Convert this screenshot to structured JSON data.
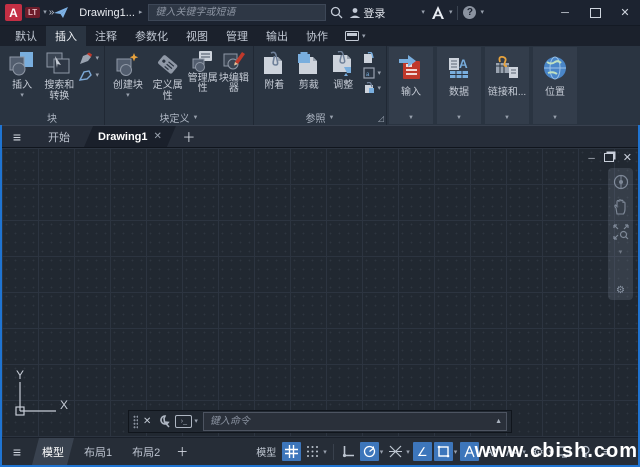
{
  "colors": {
    "accent_blue": "#1f74d2",
    "active_tool_blue": "#3d76bb",
    "titlebar_bg": "#1c2330",
    "ribbon_bg": "#2a3441",
    "canvas_bg": "#212831",
    "statusbar_bg": "#262d37",
    "app_icon_red": "#c32f44"
  },
  "glyphs": {
    "caret_down": "▾",
    "caret_down_small": "▼",
    "caret_right": "▸",
    "double_chevron": "»",
    "close": "✕",
    "minimize": "─",
    "plus": "＋",
    "hamburger": "≡",
    "up_arrow": "▲",
    "angle": "∠",
    "question": "?",
    "launcher": "◿",
    "gear": "⚙",
    "prompt": "›_"
  },
  "titlebar": {
    "app_initial": "A",
    "app_badge": "LT",
    "doc_title": "Drawing1...",
    "search_placeholder": "键入关键字或短语",
    "signin": "登录"
  },
  "ribbon_tabs": [
    {
      "label": "默认"
    },
    {
      "label": "插入"
    },
    {
      "label": "注释"
    },
    {
      "label": "参数化"
    },
    {
      "label": "视图"
    },
    {
      "label": "管理"
    },
    {
      "label": "输出"
    },
    {
      "label": "协作"
    }
  ],
  "active_ribbon_tab": "插入",
  "panels": {
    "block": {
      "title": "块",
      "insert": "插入",
      "search_convert": "搜索和转换"
    },
    "block_def": {
      "title": "块定义",
      "create": "创建块",
      "def_attr": "定义属性",
      "manage_attr": "管理属性",
      "block_editor": "块编辑器"
    },
    "reference": {
      "title": "参照",
      "attach": "附着",
      "clip": "剪裁",
      "adjust": "调整"
    },
    "collapsed": [
      {
        "label": "输入"
      },
      {
        "label": "数据"
      },
      {
        "label": "链接和..."
      },
      {
        "label": "位置"
      }
    ]
  },
  "file_tabs": {
    "start": "开始",
    "drawing": "Drawing1"
  },
  "canvas": {
    "ucs_x": "X",
    "ucs_y": "Y"
  },
  "command_line": {
    "placeholder": "键入命令"
  },
  "status_bar": {
    "layouts": [
      "模型",
      "布局1",
      "布局2"
    ],
    "model_space_label": "模型"
  },
  "watermark": "www.cbish.com"
}
